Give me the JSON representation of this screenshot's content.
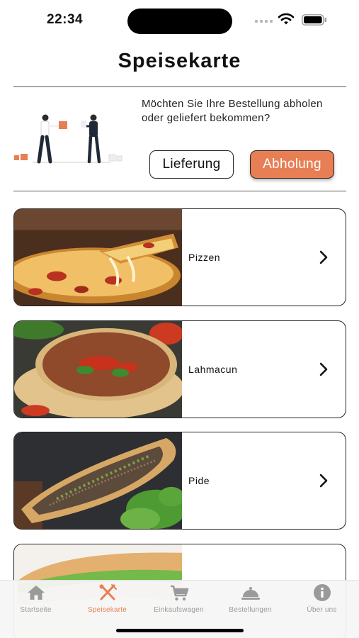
{
  "status_bar": {
    "time": "22:34"
  },
  "page": {
    "title": "Speisekarte"
  },
  "order_mode": {
    "question": "Möchten Sie Ihre Bestellung abholen oder geliefert bekommen?",
    "delivery_label": "Lieferung",
    "pickup_label": "Abholung",
    "selected": "Abholung"
  },
  "categories": [
    {
      "label": "Pizzen",
      "image_icon": "pizza-photo"
    },
    {
      "label": "Lahmacun",
      "image_icon": "lahmacun-photo"
    },
    {
      "label": "Pide",
      "image_icon": "pide-photo"
    },
    {
      "label": "",
      "image_icon": "sandwich-photo"
    }
  ],
  "tabs": [
    {
      "label": "Startseite",
      "icon": "home-icon",
      "active": false
    },
    {
      "label": "Speisekarte",
      "icon": "fork-knife-icon",
      "active": true
    },
    {
      "label": "Einkaufswagen",
      "icon": "cart-icon",
      "active": false
    },
    {
      "label": "Bestellungen",
      "icon": "cloche-icon",
      "active": false
    },
    {
      "label": "Über uns",
      "icon": "info-icon",
      "active": false
    }
  ],
  "colors": {
    "accent": "#e87e54",
    "tab_inactive": "#9a9a9a",
    "tab_bar_bg": "#f5f5f5"
  }
}
